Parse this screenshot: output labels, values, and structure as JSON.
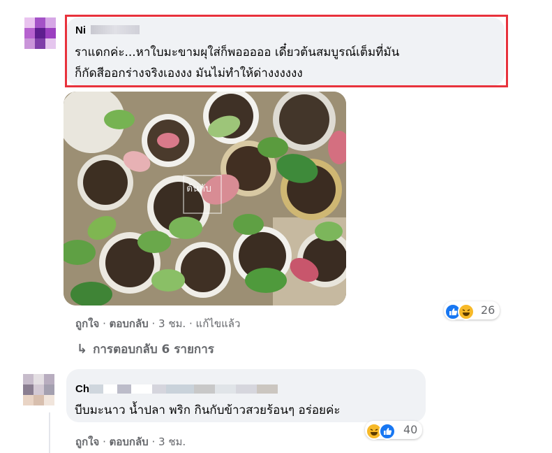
{
  "comments": [
    {
      "author": "Ni",
      "author_blurred_part": "ng Lbu",
      "lines": [
        "ราแดกค่ะ...หาใบมะขามผุใส่ก็พอออออ เดี๋ยวต้นสมบูรณ์เต็มที่มัน",
        "ก็กัดสีออกร่างจริงเองงง มันไม่ทำให้ด่างงงงงง"
      ],
      "highlight_color": "#e8323c",
      "image_icon": "plant-pots-photo",
      "watermark": "ต้นกับ",
      "actions": {
        "like": "ถูกใจ",
        "sep1": "·",
        "reply": "ตอบกลับ",
        "sep2": "·",
        "time": "3 ชม.",
        "sep3": "·",
        "edited": "แก้ไขแล้ว"
      },
      "reactions": {
        "icons": [
          "like-icon",
          "haha-icon"
        ],
        "count": "26"
      },
      "replies_link": "การตอบกลับ 6 รายการ"
    },
    {
      "author": "Ch",
      "lines": [
        "บีบมะนาว น้ำปลา พริก กินกับข้าวสวยร้อนๆ อร่อยค่ะ"
      ],
      "actions": {
        "like": "ถูกใจ",
        "sep1": "·",
        "reply": "ตอบกลับ",
        "sep2": "·",
        "time": "3 ชม."
      },
      "reactions": {
        "icons": [
          "haha-icon",
          "like-icon"
        ],
        "count": "40"
      }
    }
  ],
  "colors": {
    "bubble": "#f0f2f5",
    "meta_text": "#65676b",
    "like_blue": "#1877f2",
    "haha_yellow": "#f7b928"
  }
}
